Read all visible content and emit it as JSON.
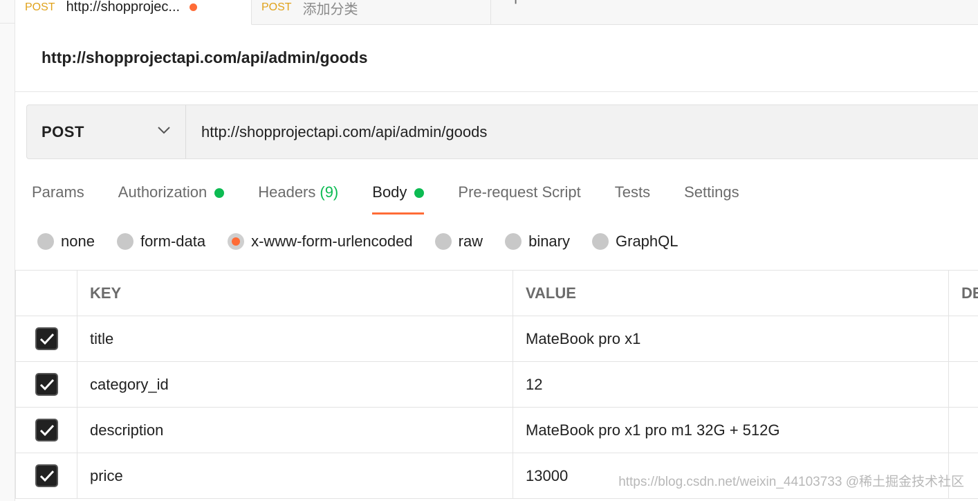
{
  "tabs": [
    {
      "method": "POST",
      "title": "http://shopprojec...",
      "unsaved": true
    },
    {
      "method": "POST",
      "title": "添加分类",
      "unsaved": false
    }
  ],
  "tab_add_label": "+",
  "request": {
    "name": "http://shopprojectapi.com/api/admin/goods",
    "method": "POST",
    "url": "http://shopprojectapi.com/api/admin/goods"
  },
  "subtabs": {
    "params": "Params",
    "authorization": "Authorization",
    "headers": "Headers",
    "headers_count": "(9)",
    "body": "Body",
    "prerequest": "Pre-request Script",
    "tests": "Tests",
    "settings": "Settings"
  },
  "body_types": {
    "none": "none",
    "form_data": "form-data",
    "urlencoded": "x-www-form-urlencoded",
    "raw": "raw",
    "binary": "binary",
    "graphql": "GraphQL",
    "selected": "x-www-form-urlencoded"
  },
  "table": {
    "headers": {
      "key": "KEY",
      "value": "VALUE",
      "description": "DE"
    },
    "rows": [
      {
        "checked": true,
        "key": "title",
        "value": "MateBook pro x1"
      },
      {
        "checked": true,
        "key": "category_id",
        "value": "12"
      },
      {
        "checked": true,
        "key": "description",
        "value": "MateBook pro x1 pro m1 32G + 512G"
      },
      {
        "checked": true,
        "key": "price",
        "value": "13000"
      }
    ]
  },
  "watermark": "https://blog.csdn.net/weixin_44103733 @稀土掘金技术社区",
  "colors": {
    "accent": "#ff6c37",
    "status_green": "#0cbb52",
    "method_orange": "#e0a21b"
  }
}
